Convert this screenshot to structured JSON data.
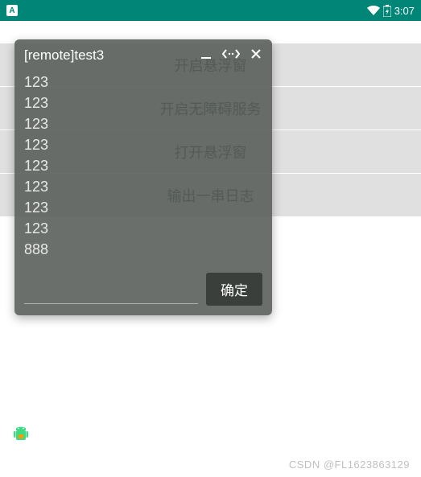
{
  "statusBar": {
    "leftIcon": "A",
    "time": "3:07"
  },
  "listItems": [
    "开启悬浮窗",
    "开启无障碍服务",
    "打开悬浮窗",
    "输出一串日志"
  ],
  "overlay": {
    "title": "[remote]test3",
    "logs": [
      "123",
      "123",
      "123",
      "123",
      "123",
      "123",
      "123",
      "123",
      "888"
    ],
    "confirmLabel": "确定"
  },
  "watermark": "CSDN @FL1623863129"
}
